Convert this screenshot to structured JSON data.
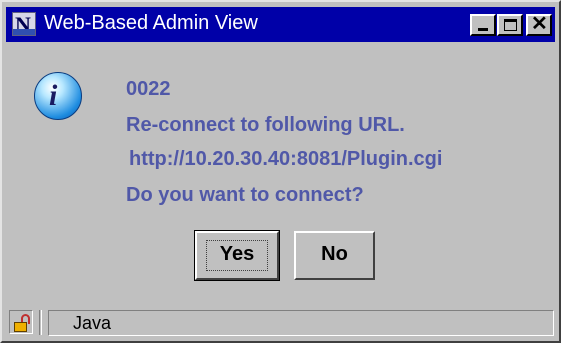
{
  "window": {
    "title": "Web-Based Admin View",
    "logo_letter": "N",
    "controls": {
      "minimize_icon": "minimize-icon",
      "maximize_icon": "maximize-icon",
      "close_icon": "close-icon",
      "close_glyph": "✕"
    }
  },
  "dialog": {
    "icon": "info-icon",
    "icon_glyph": "i",
    "code": "0022",
    "line1": "Re-connect to following URL.",
    "url": "http://10.20.30.40:8081/Plugin.cgi",
    "line2": "Do you want to connect?",
    "text_color": "#5058a8"
  },
  "buttons": {
    "yes_label": "Yes",
    "no_label": "No"
  },
  "statusbar": {
    "lock_icon": "unlocked-padlock-icon",
    "text": "Java"
  },
  "colors": {
    "titlebar": "#0000a8",
    "face": "#c0c0c0"
  }
}
